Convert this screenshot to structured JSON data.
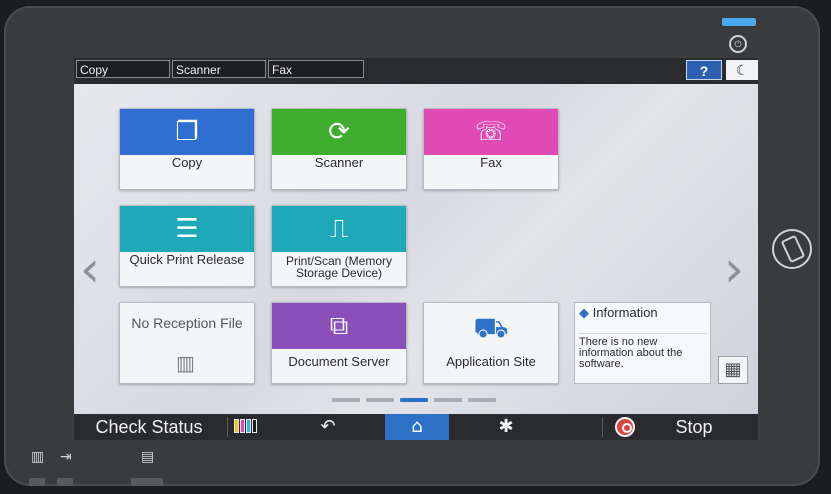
{
  "top_tabs": [
    "Copy",
    "Scanner",
    "Fax"
  ],
  "help_label": "?",
  "moon_glyph": "☾",
  "power_glyph": "⏻",
  "tiles": {
    "copy": {
      "label": "Copy",
      "color": "#2f6fd2",
      "icon": "copy-icon",
      "glyph": "❐"
    },
    "scanner": {
      "label": "Scanner",
      "color": "#3fae2f",
      "icon": "scanner-icon",
      "glyph": "⟳"
    },
    "fax": {
      "label": "Fax",
      "color": "#e04ab4",
      "icon": "fax-icon",
      "glyph": "☏"
    },
    "quick_print": {
      "label": "Quick Print Release",
      "color": "#1fa8b8",
      "icon": "print-icon",
      "glyph": "☰"
    },
    "print_scan": {
      "label_line1": "Print/Scan (Memory",
      "label_line2": "Storage Device)",
      "color": "#1fa8b8",
      "icon": "usb-icon",
      "glyph": "⎍"
    },
    "no_reception": {
      "label": "No Reception File",
      "icon": "fax-machine-icon",
      "glyph": "▥"
    },
    "document_server": {
      "label": "Document Server",
      "color": "#8a4fb8",
      "icon": "document-server-icon",
      "glyph": "⧉"
    },
    "application_site": {
      "label": "Application Site",
      "icon": "shopping-bag-icon",
      "glyph": "⛟"
    }
  },
  "info_widget": {
    "title": "Information",
    "text": "There is no new information about the software."
  },
  "arrows": {
    "left": "‹",
    "right": "›"
  },
  "grid_glyph": "▦",
  "pagination": {
    "count": 5,
    "active_index": 3
  },
  "bottom_bar": {
    "check_status": "Check Status",
    "toner_colors": [
      "#f2c417",
      "#e04ab4",
      "#2fb3e8",
      "#1a1a1a"
    ],
    "back_glyph": "↶",
    "home_glyph": "⌂",
    "settings_glyph": "✱",
    "stop_label": "Stop"
  },
  "hw_glyphs": {
    "fax": "▥",
    "in": "⇥",
    "doc": "▤"
  }
}
